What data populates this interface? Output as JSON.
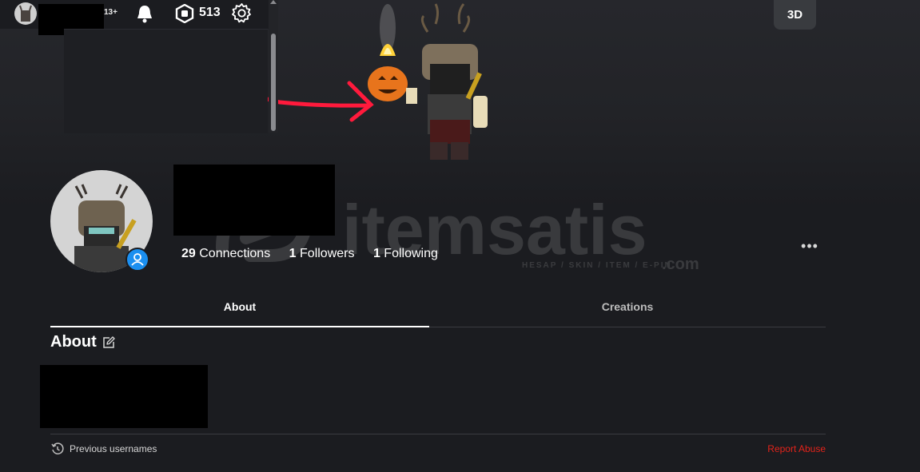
{
  "header": {
    "age_label": "13+",
    "robux_amount": "513"
  },
  "banner": {
    "view_mode_label": "3D"
  },
  "profile": {
    "stats": [
      {
        "count": "29",
        "label": "Connections"
      },
      {
        "count": "1",
        "label": "Followers"
      },
      {
        "count": "1",
        "label": "Following"
      }
    ],
    "more_label": "•••"
  },
  "watermark": {
    "brand": "itemsatis",
    "tagline": "HESAP / SKIN / ITEM / E-PIN",
    "suffix": ".com"
  },
  "tabs": [
    {
      "label": "About",
      "active": true
    },
    {
      "label": "Creations",
      "active": false
    }
  ],
  "about": {
    "heading": "About"
  },
  "footer": {
    "previous_usernames": "Previous usernames",
    "report_abuse": "Report Abuse"
  },
  "colors": {
    "background": "#1b1c20",
    "accent_blue": "#1b8ff0",
    "report_red": "#e2231a",
    "annotation_red": "#ff1a3c"
  },
  "icons": [
    "bell-icon",
    "robux-icon",
    "gear-icon",
    "edit-icon",
    "history-icon",
    "person-icon"
  ]
}
